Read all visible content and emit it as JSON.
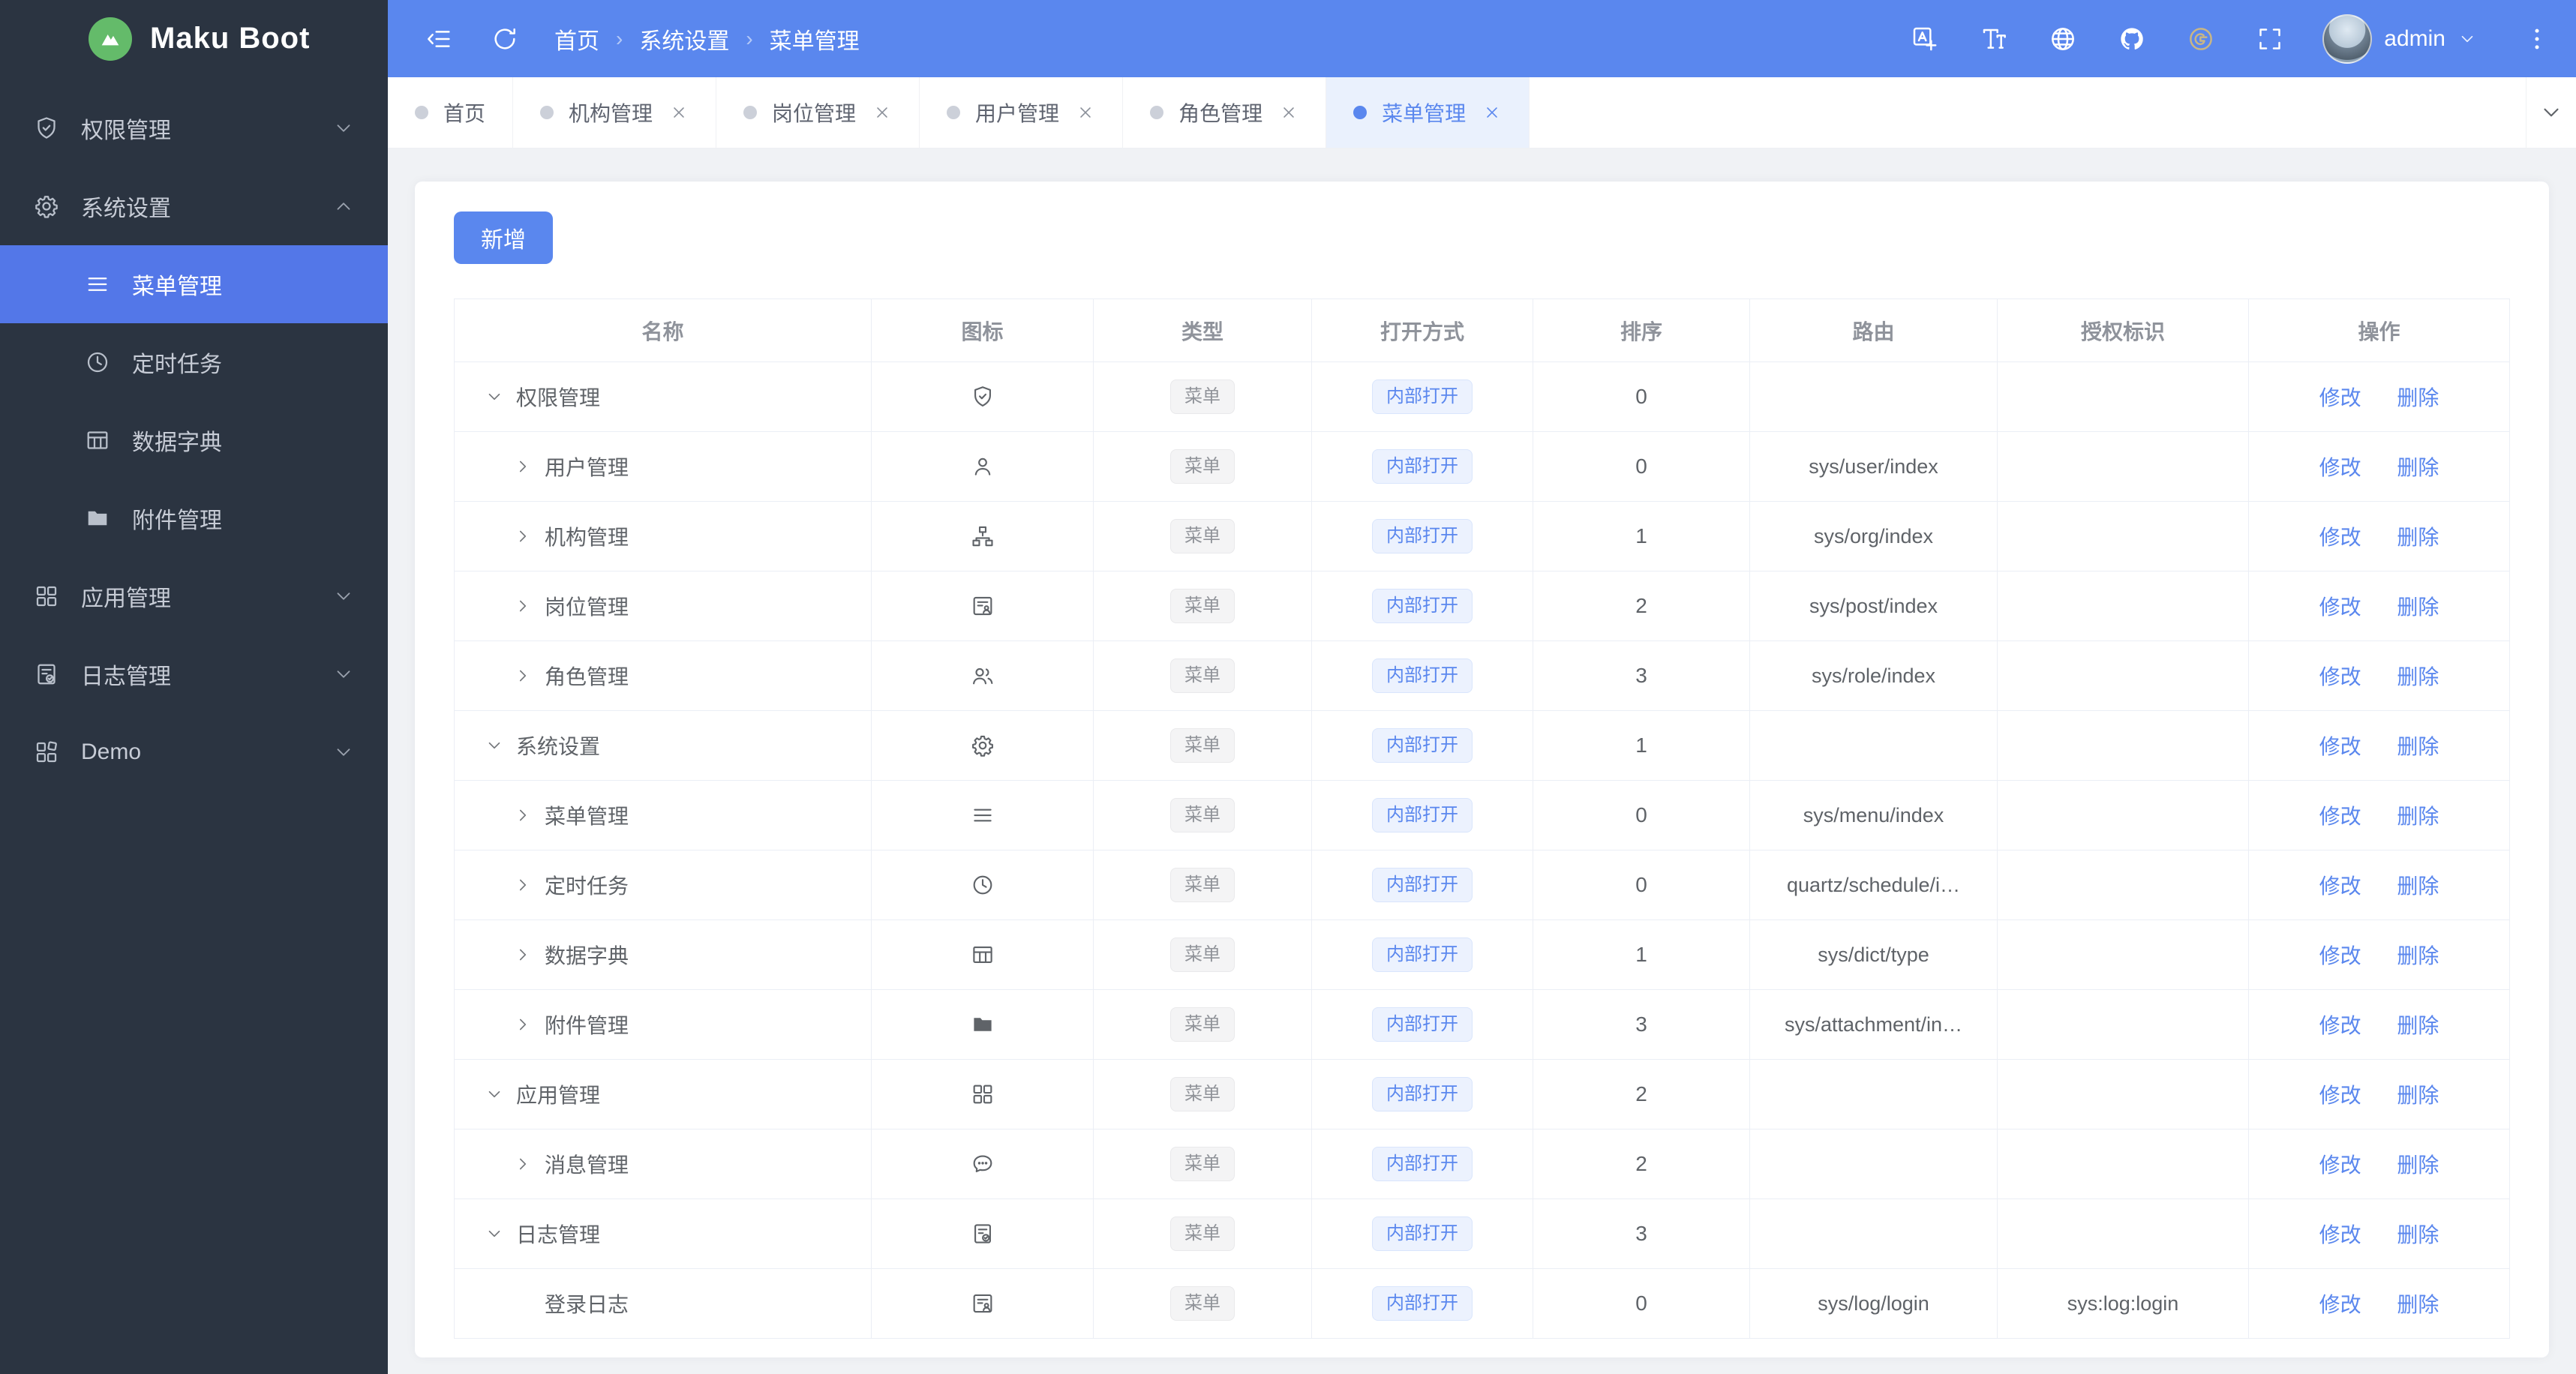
{
  "app": {
    "title": "Maku Boot"
  },
  "colors": {
    "accent": "#5a87ee",
    "sidebar_bg": "#2b3441",
    "sidebar_active": "#5377e8",
    "logo_green": "#64bb6a",
    "tab_active_bg": "#eaf1fd",
    "page_bg": "#f0f2f5",
    "link": "#5a87ee",
    "gitee_gold": "#c9b685",
    "type_badge_bg": "#f4f4f5",
    "type_badge_text": "#909399",
    "open_badge_bg": "#ecf2fe",
    "open_badge_text": "#5a87ee",
    "row_border": "#ebeef5"
  },
  "sidebar": {
    "items": [
      {
        "label": "权限管理",
        "icon": "shield-check",
        "kind": "top",
        "chevron": "down",
        "active": false
      },
      {
        "label": "系统设置",
        "icon": "gear",
        "kind": "top",
        "chevron": "up",
        "active": false
      },
      {
        "label": "菜单管理",
        "icon": "menu-lines",
        "kind": "sub",
        "chevron": "",
        "active": true
      },
      {
        "label": "定时任务",
        "icon": "clock",
        "kind": "sub",
        "chevron": "",
        "active": false
      },
      {
        "label": "数据字典",
        "icon": "table-grid",
        "kind": "sub",
        "chevron": "",
        "active": false
      },
      {
        "label": "附件管理",
        "icon": "folder",
        "kind": "sub",
        "chevron": "",
        "active": false
      },
      {
        "label": "应用管理",
        "icon": "grid-squares",
        "kind": "top",
        "chevron": "down",
        "active": false
      },
      {
        "label": "日志管理",
        "icon": "doc-check",
        "kind": "top",
        "chevron": "down",
        "active": false
      },
      {
        "label": "Demo",
        "icon": "grid-alt",
        "kind": "top",
        "chevron": "down",
        "active": false
      }
    ]
  },
  "header": {
    "breadcrumb": [
      "首页",
      "系统设置",
      "菜单管理"
    ],
    "user": "admin"
  },
  "tabs": [
    {
      "label": "首页",
      "closable": false,
      "active": false
    },
    {
      "label": "机构管理",
      "closable": true,
      "active": false
    },
    {
      "label": "岗位管理",
      "closable": true,
      "active": false
    },
    {
      "label": "用户管理",
      "closable": true,
      "active": false
    },
    {
      "label": "角色管理",
      "closable": true,
      "active": false
    },
    {
      "label": "菜单管理",
      "closable": true,
      "active": true
    }
  ],
  "toolbar": {
    "add_label": "新增"
  },
  "table": {
    "columns": [
      "名称",
      "图标",
      "类型",
      "打开方式",
      "排序",
      "路由",
      "授权标识",
      "操作"
    ],
    "actions": {
      "edit": "修改",
      "delete": "删除"
    },
    "rows": [
      {
        "level": 1,
        "expand": "open",
        "icon": "shield-check",
        "name": "权限管理",
        "type": "菜单",
        "open": "内部打开",
        "sort": "0",
        "route": "",
        "perm": ""
      },
      {
        "level": 2,
        "expand": "closed",
        "icon": "user",
        "name": "用户管理",
        "type": "菜单",
        "open": "内部打开",
        "sort": "0",
        "route": "sys/user/index",
        "perm": ""
      },
      {
        "level": 2,
        "expand": "closed",
        "icon": "org-tree",
        "name": "机构管理",
        "type": "菜单",
        "open": "内部打开",
        "sort": "1",
        "route": "sys/org/index",
        "perm": ""
      },
      {
        "level": 2,
        "expand": "closed",
        "icon": "id-card",
        "name": "岗位管理",
        "type": "菜单",
        "open": "内部打开",
        "sort": "2",
        "route": "sys/post/index",
        "perm": ""
      },
      {
        "level": 2,
        "expand": "closed",
        "icon": "users",
        "name": "角色管理",
        "type": "菜单",
        "open": "内部打开",
        "sort": "3",
        "route": "sys/role/index",
        "perm": ""
      },
      {
        "level": 1,
        "expand": "open",
        "icon": "gear",
        "name": "系统设置",
        "type": "菜单",
        "open": "内部打开",
        "sort": "1",
        "route": "",
        "perm": ""
      },
      {
        "level": 2,
        "expand": "closed",
        "icon": "menu-lines",
        "name": "菜单管理",
        "type": "菜单",
        "open": "内部打开",
        "sort": "0",
        "route": "sys/menu/index",
        "perm": ""
      },
      {
        "level": 2,
        "expand": "closed",
        "icon": "clock",
        "name": "定时任务",
        "type": "菜单",
        "open": "内部打开",
        "sort": "0",
        "route": "quartz/schedule/i…",
        "perm": ""
      },
      {
        "level": 2,
        "expand": "closed",
        "icon": "table-grid",
        "name": "数据字典",
        "type": "菜单",
        "open": "内部打开",
        "sort": "1",
        "route": "sys/dict/type",
        "perm": ""
      },
      {
        "level": 2,
        "expand": "closed",
        "icon": "folder",
        "name": "附件管理",
        "type": "菜单",
        "open": "内部打开",
        "sort": "3",
        "route": "sys/attachment/in…",
        "perm": ""
      },
      {
        "level": 1,
        "expand": "open",
        "icon": "grid-squares",
        "name": "应用管理",
        "type": "菜单",
        "open": "内部打开",
        "sort": "2",
        "route": "",
        "perm": ""
      },
      {
        "level": 2,
        "expand": "closed",
        "icon": "chat-dots",
        "name": "消息管理",
        "type": "菜单",
        "open": "内部打开",
        "sort": "2",
        "route": "",
        "perm": ""
      },
      {
        "level": 1,
        "expand": "open",
        "icon": "doc-check",
        "name": "日志管理",
        "type": "菜单",
        "open": "内部打开",
        "sort": "3",
        "route": "",
        "perm": ""
      },
      {
        "level": 2,
        "expand": "none",
        "icon": "id-card",
        "name": "登录日志",
        "type": "菜单",
        "open": "内部打开",
        "sort": "0",
        "route": "sys/log/login",
        "perm": "sys:log:login"
      }
    ]
  }
}
